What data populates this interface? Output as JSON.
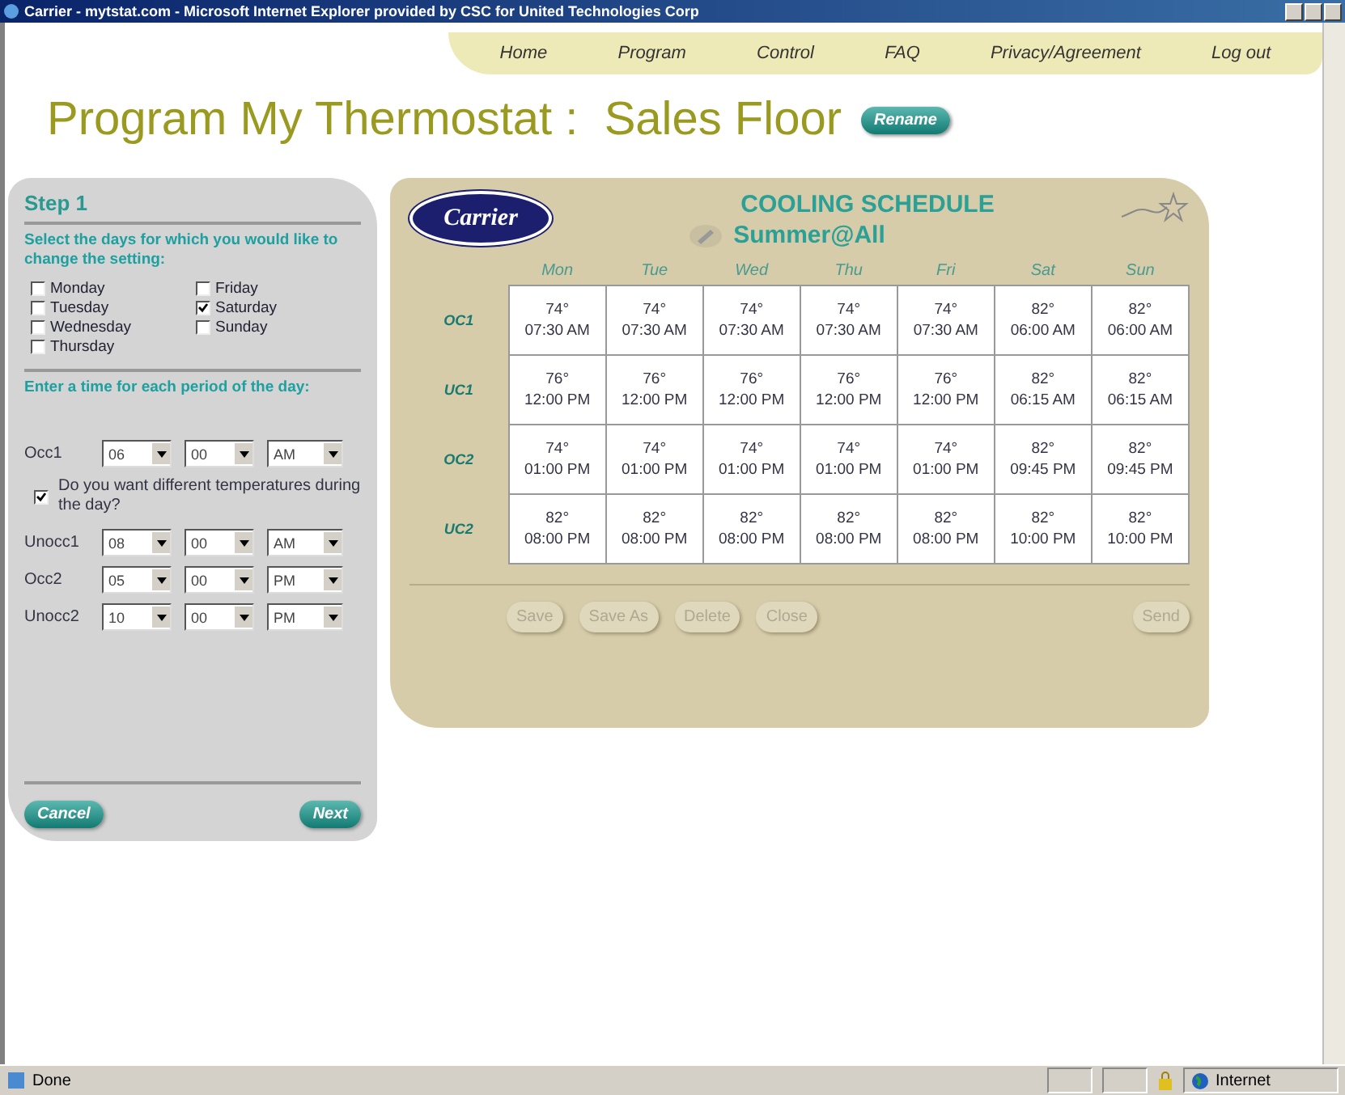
{
  "window": {
    "title": "Carrier - mytstat.com - Microsoft Internet Explorer provided by CSC for United Technologies Corp"
  },
  "nav": [
    {
      "label": "Home"
    },
    {
      "label": "Program"
    },
    {
      "label": "Control"
    },
    {
      "label": "FAQ"
    },
    {
      "label": "Privacy/Agreement"
    },
    {
      "label": "Log out"
    }
  ],
  "heading": "Program My Thermostat :  Sales Floor",
  "rename_button": "Rename",
  "step_panel": {
    "title": "Step 1",
    "days_prompt": "Select the days for which you would like to change the setting:",
    "days": [
      {
        "label": "Monday",
        "checked": false
      },
      {
        "label": "Tuesday",
        "checked": false
      },
      {
        "label": "Wednesday",
        "checked": false
      },
      {
        "label": "Thursday",
        "checked": false
      },
      {
        "label": "Friday",
        "checked": false
      },
      {
        "label": "Saturday",
        "checked": true
      },
      {
        "label": "Sunday",
        "checked": false
      }
    ],
    "time_prompt": "Enter a time for each period of the day:",
    "periods": [
      {
        "kind": "time",
        "label": "Occ1",
        "hour": "06",
        "minute": "00",
        "ampm": "AM"
      },
      {
        "kind": "checkbox",
        "label": "Do you want different temperatures during the day?",
        "checked": true
      },
      {
        "kind": "time",
        "label": "Unocc1",
        "hour": "08",
        "minute": "00",
        "ampm": "AM"
      },
      {
        "kind": "time",
        "label": "Occ2",
        "hour": "05",
        "minute": "00",
        "ampm": "PM"
      },
      {
        "kind": "time",
        "label": "Unocc2",
        "hour": "10",
        "minute": "00",
        "ampm": "PM"
      }
    ],
    "buttons": [
      "Cancel",
      "Next"
    ]
  },
  "schedule": {
    "logo": "Carrier",
    "title": "COOLING SCHEDULE",
    "season": "Summer@All",
    "days": [
      "Mon",
      "Tue",
      "Wed",
      "Thu",
      "Fri",
      "Sat",
      "Sun"
    ],
    "rows": [
      {
        "label": "OC1",
        "cells": [
          [
            "74°",
            "07:30 AM"
          ],
          [
            "74°",
            "07:30 AM"
          ],
          [
            "74°",
            "07:30 AM"
          ],
          [
            "74°",
            "07:30 AM"
          ],
          [
            "74°",
            "07:30 AM"
          ],
          [
            "82°",
            "06:00 AM"
          ],
          [
            "82°",
            "06:00 AM"
          ]
        ]
      },
      {
        "label": "UC1",
        "cells": [
          [
            "76°",
            "12:00 PM"
          ],
          [
            "76°",
            "12:00 PM"
          ],
          [
            "76°",
            "12:00 PM"
          ],
          [
            "76°",
            "12:00 PM"
          ],
          [
            "76°",
            "12:00 PM"
          ],
          [
            "82°",
            "06:15 AM"
          ],
          [
            "82°",
            "06:15 AM"
          ]
        ]
      },
      {
        "label": "OC2",
        "cells": [
          [
            "74°",
            "01:00 PM"
          ],
          [
            "74°",
            "01:00 PM"
          ],
          [
            "74°",
            "01:00 PM"
          ],
          [
            "74°",
            "01:00 PM"
          ],
          [
            "74°",
            "01:00 PM"
          ],
          [
            "82°",
            "09:45 PM"
          ],
          [
            "82°",
            "09:45 PM"
          ]
        ]
      },
      {
        "label": "UC2",
        "cells": [
          [
            "82°",
            "08:00 PM"
          ],
          [
            "82°",
            "08:00 PM"
          ],
          [
            "82°",
            "08:00 PM"
          ],
          [
            "82°",
            "08:00 PM"
          ],
          [
            "82°",
            "08:00 PM"
          ],
          [
            "82°",
            "10:00 PM"
          ],
          [
            "82°",
            "10:00 PM"
          ]
        ]
      }
    ],
    "buttons": [
      {
        "label": "Save",
        "disabled": true
      },
      {
        "label": "Save As",
        "disabled": true
      },
      {
        "label": "Delete",
        "disabled": true
      },
      {
        "label": "Close",
        "disabled": true
      }
    ],
    "send_button": {
      "label": "Send",
      "disabled": true
    }
  },
  "status_bar": {
    "text": "Done",
    "zone": "Internet"
  }
}
